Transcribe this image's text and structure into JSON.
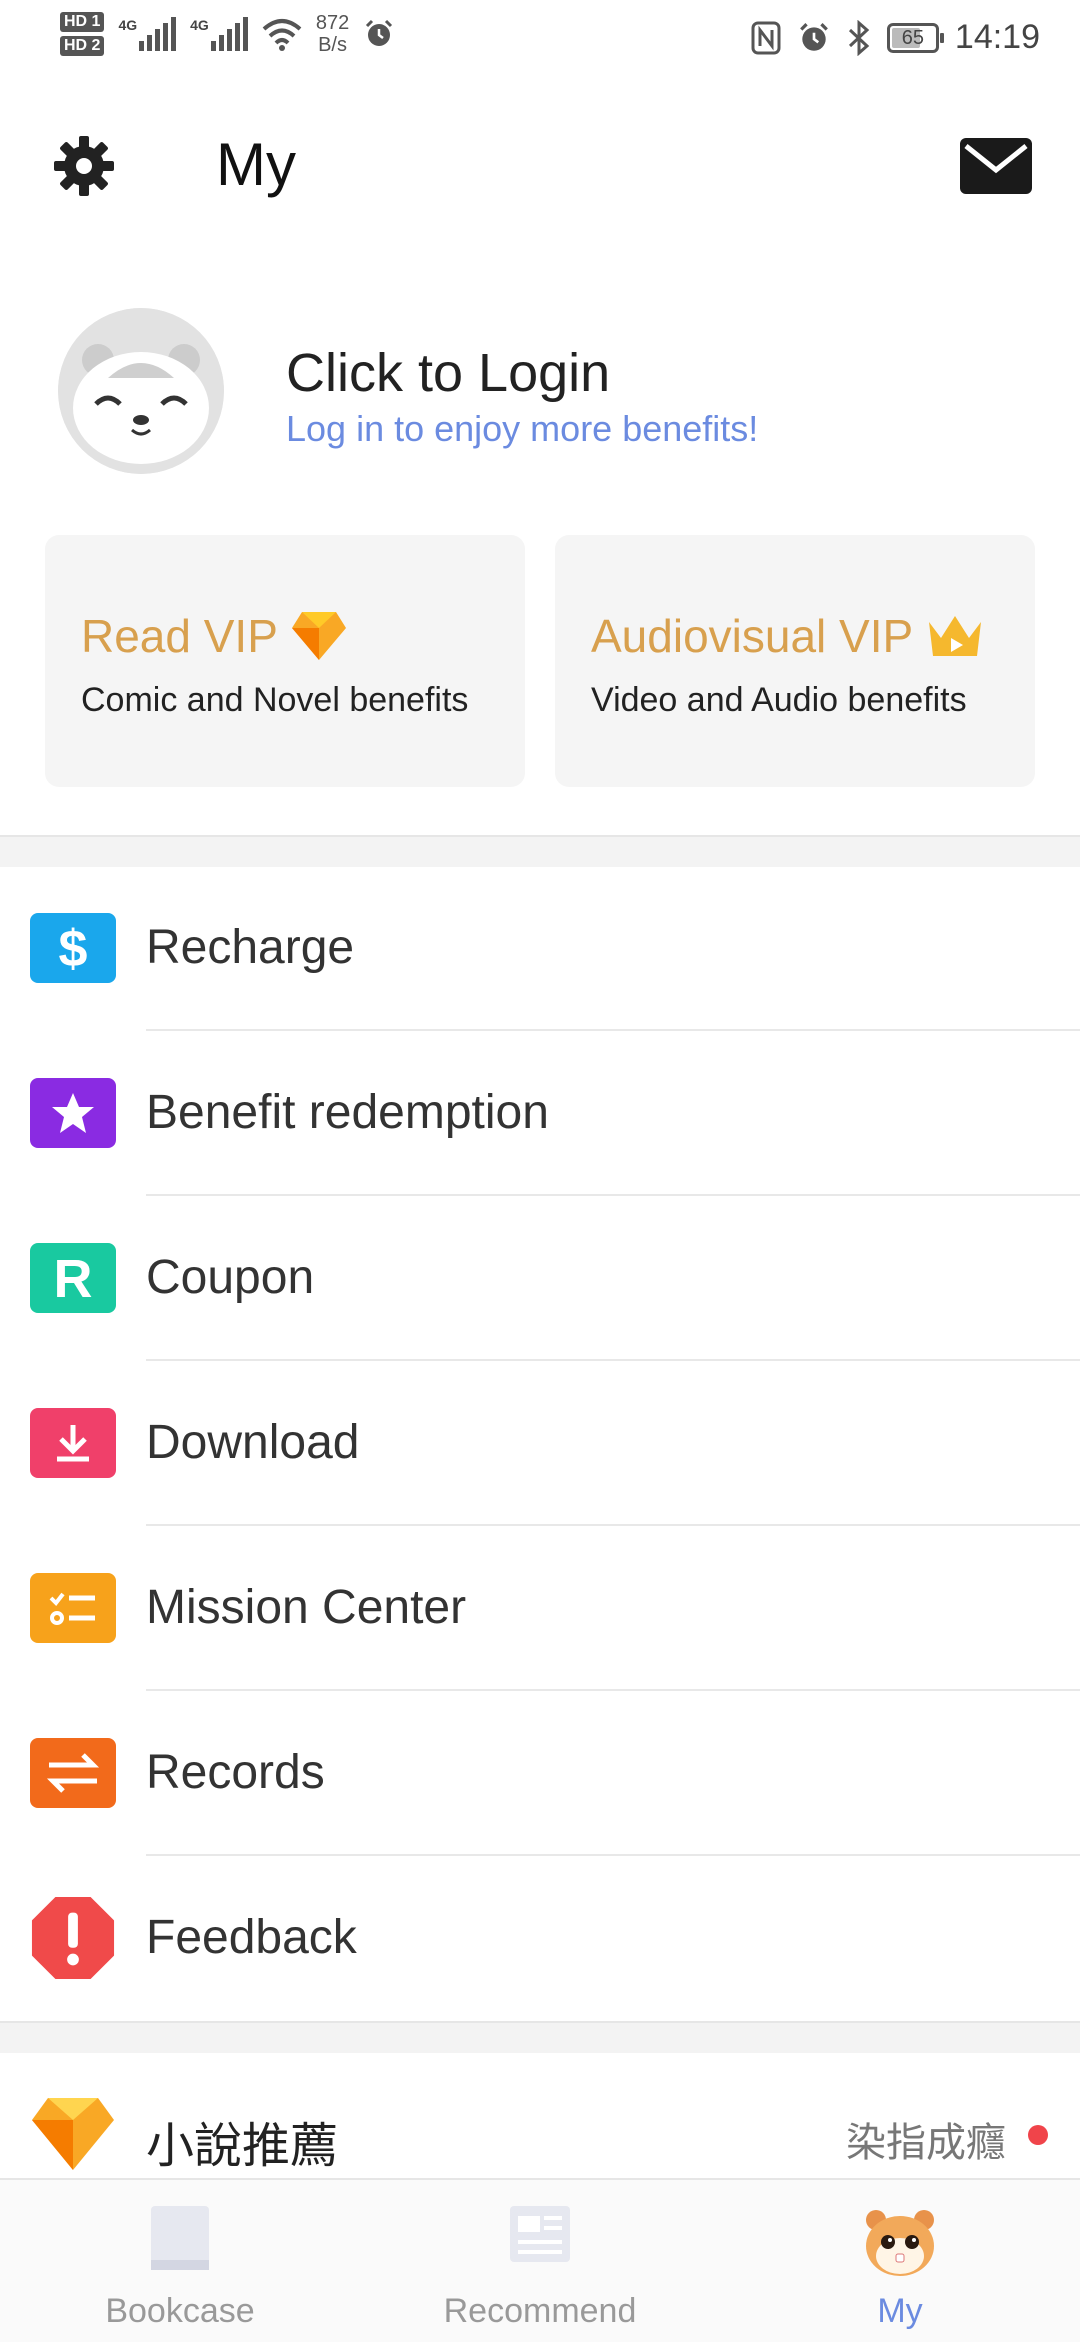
{
  "status_bar": {
    "hd1": "HD 1",
    "hd2": "HD 2",
    "net1": "4G",
    "net2": "4G",
    "speed_value": "872",
    "speed_unit": "B/s",
    "battery": "65",
    "time": "14:19"
  },
  "header": {
    "title": "My"
  },
  "profile": {
    "login_title": "Click to Login",
    "login_subtitle": "Log in to enjoy more benefits!"
  },
  "vip_cards": [
    {
      "title": "Read VIP",
      "subtitle": "Comic and Novel benefits",
      "icon": "diamond-icon"
    },
    {
      "title": "Audiovisual VIP",
      "subtitle": "Video and Audio benefits",
      "icon": "crown-icon"
    }
  ],
  "menu": [
    {
      "label": "Recharge",
      "icon": "dollar-icon",
      "color": "#1aa7ec"
    },
    {
      "label": "Benefit redemption",
      "icon": "star-ticket-icon",
      "color": "#8a2be2"
    },
    {
      "label": "Coupon",
      "icon": "coupon-r-icon",
      "color": "#19c9a0"
    },
    {
      "label": "Download",
      "icon": "download-icon",
      "color": "#f0406a"
    },
    {
      "label": "Mission Center",
      "icon": "checklist-icon",
      "color": "#f7a21b"
    },
    {
      "label": "Records",
      "icon": "swap-arrows-icon",
      "color": "#f26a1b"
    },
    {
      "label": "Feedback",
      "icon": "exclamation-icon",
      "color": "#f04a4a"
    }
  ],
  "novel_section": {
    "title": "小說推薦",
    "right_text": "染指成癮"
  },
  "bottom_nav": [
    {
      "label": "Bookcase",
      "icon": "book-icon"
    },
    {
      "label": "Recommend",
      "icon": "news-icon"
    },
    {
      "label": "My",
      "icon": "hamster-icon",
      "active": true
    }
  ],
  "colors": {
    "accent": "#6b8be0",
    "vip_gold": "#d8a04e"
  }
}
